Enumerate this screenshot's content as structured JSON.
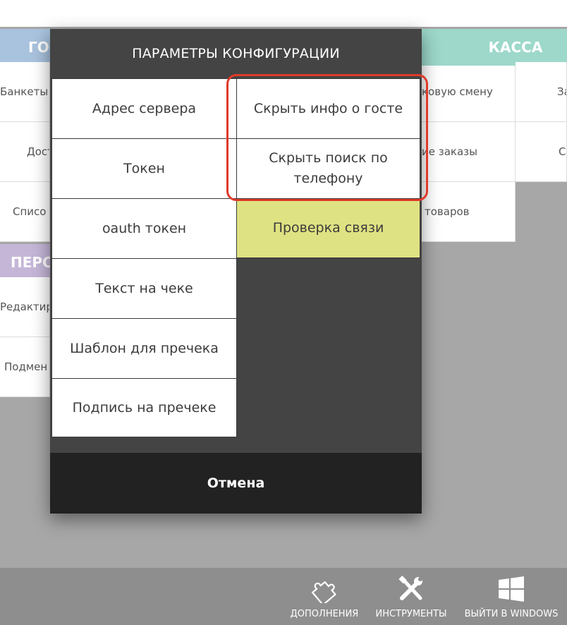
{
  "background": {
    "left_section": {
      "header": "ГОС",
      "header_color": "#a9c3de",
      "items": [
        "Банкеты и",
        "Дост",
        "Списо"
      ]
    },
    "middle_section": {
      "items": [
        "ковую смену",
        "ие заказы",
        "товаров"
      ]
    },
    "kassa_section": {
      "header": "КАССА",
      "header_color": "#9dd8cb",
      "items": [
        "За",
        "С"
      ]
    },
    "personnel_section": {
      "header": "ПЕРС",
      "header_color": "#c5b6d8",
      "items": [
        "Редактиро",
        "Подмен"
      ]
    }
  },
  "dialog": {
    "title": "ПАРАМЕТРЫ КОНФИГУРАЦИИ",
    "left_options": [
      "Адрес сервера",
      "Токен",
      "oauth токен",
      "Текст на чеке",
      "Шаблон для пречека",
      "Подпись на пречеке"
    ],
    "right_options": [
      "Скрыть инфо о госте",
      "Скрыть поиск по телефону",
      "Проверка связи"
    ],
    "cancel_label": "Отмена",
    "highlight_color": "#e03a2a",
    "accent_color": "#dfe282"
  },
  "taskbar": {
    "items": [
      {
        "label": "ДОПОЛНЕНИЯ",
        "icon": "puzzle-icon"
      },
      {
        "label": "ИНСТРУМЕНТЫ",
        "icon": "tools-icon"
      },
      {
        "label": "ВЫЙТИ В WINDOWS",
        "icon": "windows-icon"
      }
    ]
  }
}
